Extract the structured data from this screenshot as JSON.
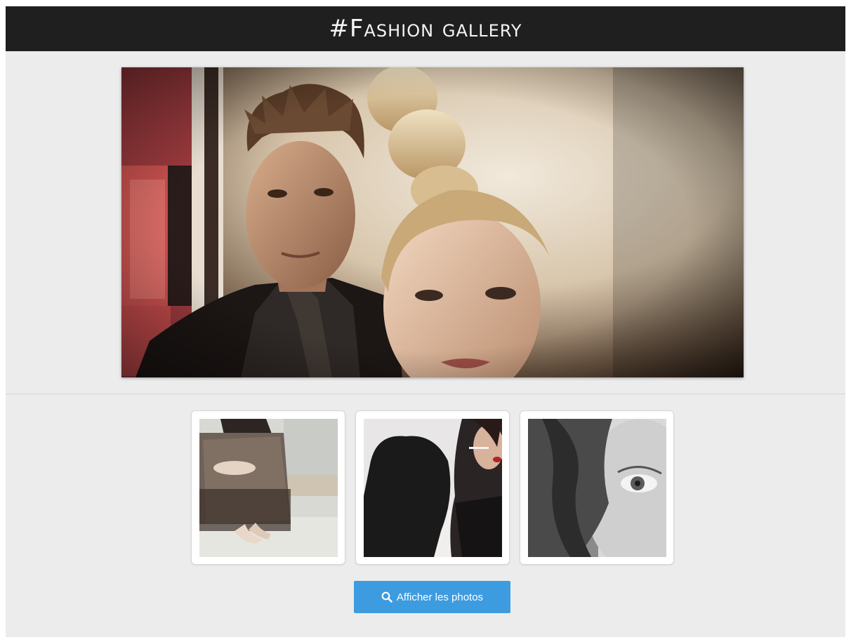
{
  "header": {
    "title": "#Fashion gallery"
  },
  "hero": {
    "icon": "hero-photo"
  },
  "thumbnails": [
    {
      "icon": "thumbnail-photo"
    },
    {
      "icon": "thumbnail-photo"
    },
    {
      "icon": "thumbnail-photo"
    }
  ],
  "actions": {
    "show_photos_label": "Afficher les photos",
    "show_photos_icon": "search-icon",
    "accent_color": "#3d9be0"
  },
  "colors": {
    "header_bg": "#1f1f1f",
    "page_bg": "#ececec"
  }
}
